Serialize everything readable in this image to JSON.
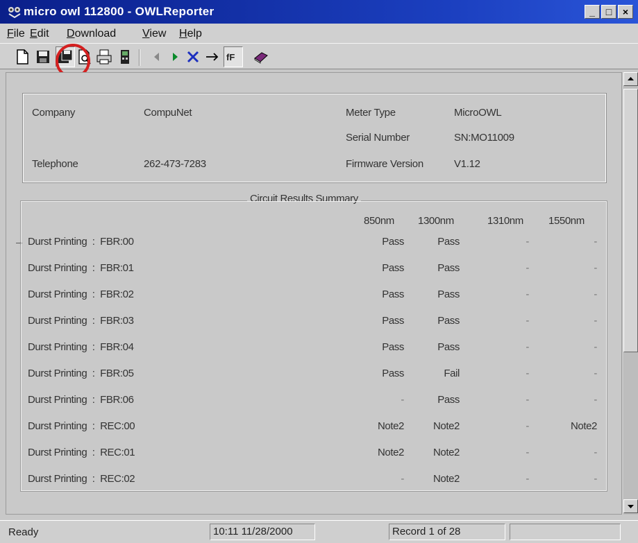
{
  "window": {
    "title": "micro owl 112800 - OWLReporter"
  },
  "menu": [
    "File",
    "Edit",
    "Download",
    "View",
    "Help"
  ],
  "toolbar_icons": [
    "new-icon",
    "save-icon",
    "save-all-icon",
    "print-preview-icon",
    "print-icon",
    "meter-icon",
    "first-icon",
    "next-icon",
    "delete-icon",
    "go-icon",
    "fiber-icon",
    "book-icon"
  ],
  "info": {
    "company_label": "Company",
    "company_value": "CompuNet",
    "telephone_label": "Telephone",
    "telephone_value": "262-473-7283",
    "meter_type_label": "Meter Type",
    "meter_type_value": "MicroOWL",
    "serial_label": "Serial Number",
    "serial_value": "SN:MO11009",
    "firmware_label": "Firmware Version",
    "firmware_value": "V1.12"
  },
  "summary": {
    "title": "Circuit Results Summary",
    "columns": [
      "850nm",
      "1300nm",
      "1310nm",
      "1550nm"
    ],
    "rows": [
      {
        "name": "Durst Printing  :  FBR:00",
        "v850": "Pass",
        "v1300": "Pass",
        "v1310": "-",
        "v1550": "-"
      },
      {
        "name": "Durst Printing  :  FBR:01",
        "v850": "Pass",
        "v1300": "Pass",
        "v1310": "-",
        "v1550": "-"
      },
      {
        "name": "Durst Printing  :  FBR:02",
        "v850": "Pass",
        "v1300": "Pass",
        "v1310": "-",
        "v1550": "-"
      },
      {
        "name": "Durst Printing  :  FBR:03",
        "v850": "Pass",
        "v1300": "Pass",
        "v1310": "-",
        "v1550": "-"
      },
      {
        "name": "Durst Printing  :  FBR:04",
        "v850": "Pass",
        "v1300": "Pass",
        "v1310": "-",
        "v1550": "-"
      },
      {
        "name": "Durst Printing  :  FBR:05",
        "v850": "Pass",
        "v1300": "Fail",
        "v1310": "-",
        "v1550": "-"
      },
      {
        "name": "Durst Printing  :  FBR:06",
        "v850": "-",
        "v1300": "Pass",
        "v1310": "-",
        "v1550": "-"
      },
      {
        "name": "Durst Printing  :  REC:00",
        "v850": "Note2",
        "v1300": "Note2",
        "v1310": "-",
        "v1550": "Note2"
      },
      {
        "name": "Durst Printing  :  REC:01",
        "v850": "Note2",
        "v1300": "Note2",
        "v1310": "-",
        "v1550": "-"
      },
      {
        "name": "Durst Printing  :  REC:02",
        "v850": "-",
        "v1300": "Note2",
        "v1310": "-",
        "v1550": "-"
      }
    ]
  },
  "status": {
    "ready": "Ready",
    "datetime": "10:11  11/28/2000",
    "record": "Record 1 of 28"
  },
  "colors": {
    "titlebar": "#0a1f8a",
    "highlight_circle": "#d42020"
  }
}
